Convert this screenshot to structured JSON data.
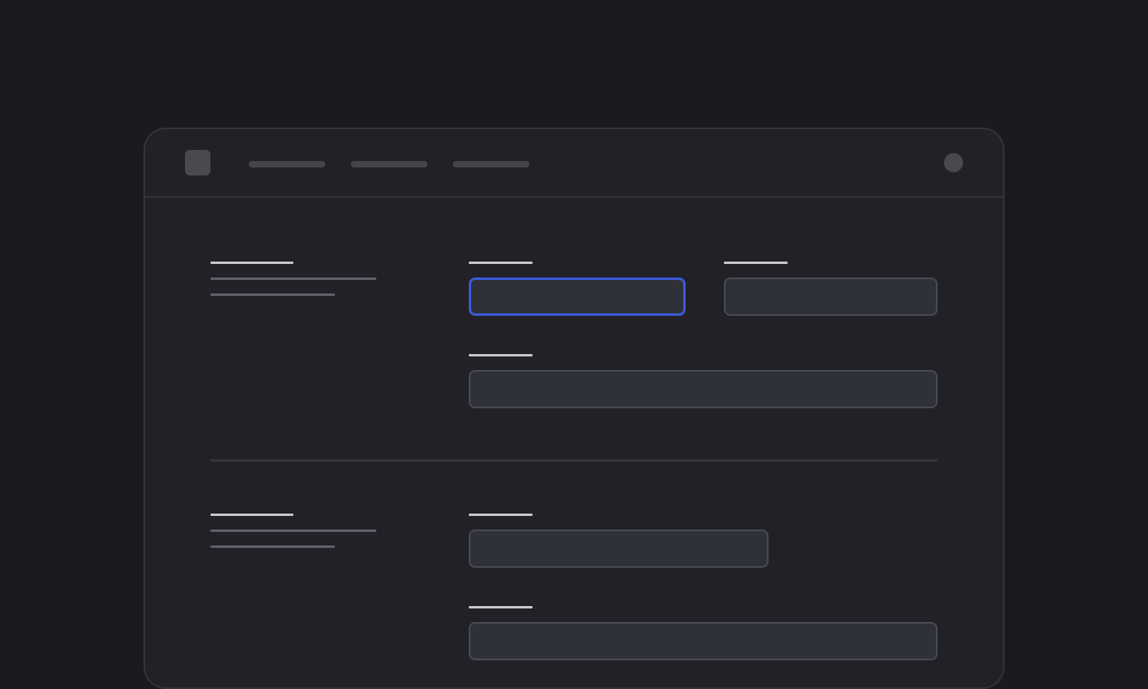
{
  "colors": {
    "background": "#1b1a1f",
    "window": "#222127",
    "input_fill": "#2f3139",
    "focus_accent": "#3b5bdb"
  },
  "header": {
    "nav_items": [
      {
        "id": "nav-1"
      },
      {
        "id": "nav-2"
      },
      {
        "id": "nav-3"
      }
    ]
  },
  "sections": [
    {
      "id": "section-1",
      "fields": [
        "field-1",
        "field-2",
        "field-3"
      ]
    },
    {
      "id": "section-2",
      "fields": [
        "field-4",
        "field-5"
      ]
    }
  ],
  "focused_field": "field-1"
}
